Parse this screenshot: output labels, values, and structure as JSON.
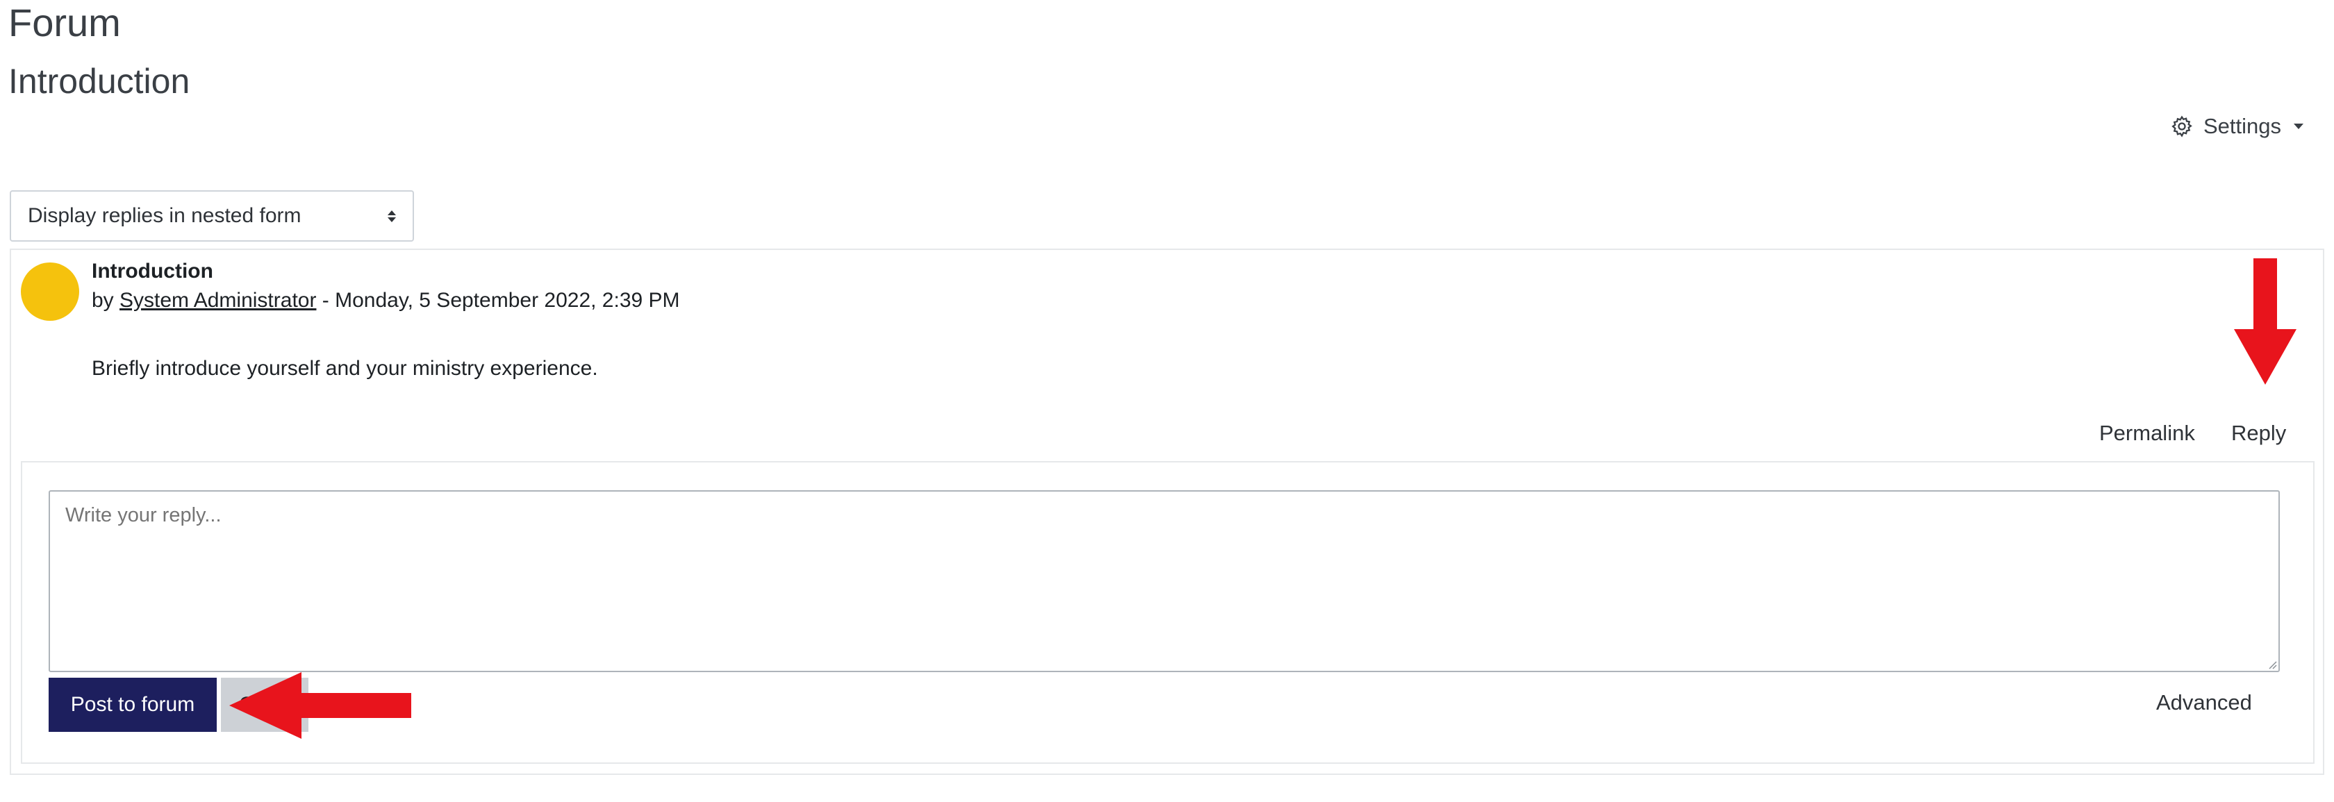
{
  "page": {
    "heading": "Forum",
    "subheading": "Introduction"
  },
  "settings": {
    "label": "Settings",
    "icon": "gear-icon"
  },
  "display_mode": {
    "selected": "Display replies in nested form"
  },
  "post": {
    "subject": "Introduction",
    "by_prefix": "by",
    "author": "System Administrator",
    "date_sep": " - Monday, 5 September 2022, 2:39 PM",
    "body": "Briefly introduce yourself and your ministry experience.",
    "avatar_color": "#f5c20d",
    "actions": {
      "permalink": "Permalink",
      "reply": "Reply"
    }
  },
  "reply_form": {
    "placeholder": "Write your reply...",
    "submit_label": "Post to forum",
    "cancel_label": "Cancel",
    "advanced_label": "Advanced"
  },
  "colors": {
    "primary_button": "#1d1f5e",
    "annotation_arrow": "#e8141c"
  }
}
